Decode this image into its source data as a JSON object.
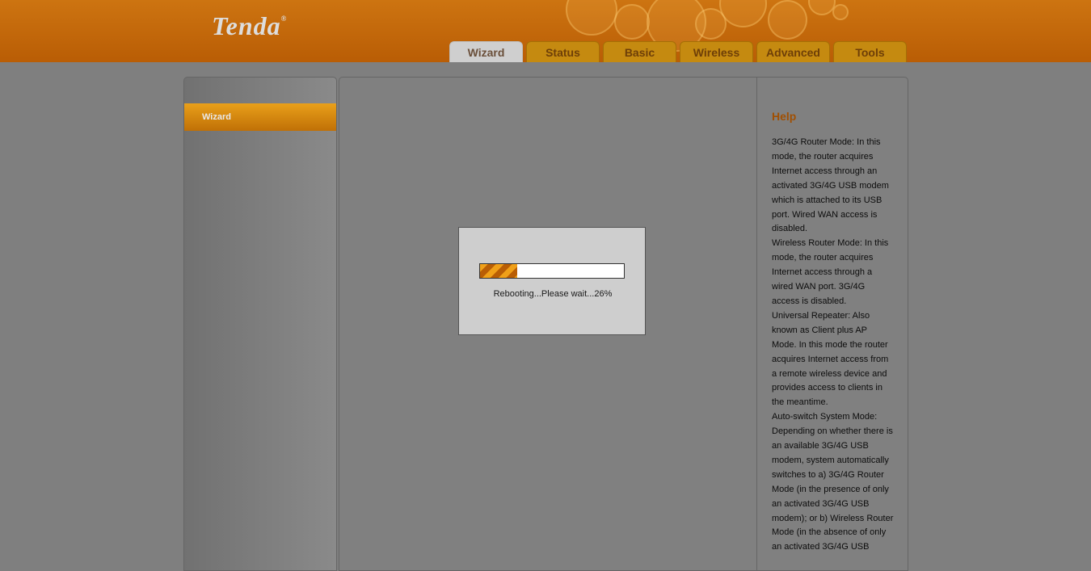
{
  "brand": {
    "logo_text": "Tenda",
    "trademark": "®"
  },
  "tabs": [
    {
      "label": "Wizard",
      "active": true
    },
    {
      "label": "Status",
      "active": false
    },
    {
      "label": "Basic",
      "active": false
    },
    {
      "label": "Wireless",
      "active": false
    },
    {
      "label": "Advanced",
      "active": false
    },
    {
      "label": "Tools",
      "active": false
    }
  ],
  "sidebar": {
    "items": [
      {
        "label": "Wizard",
        "active": true
      }
    ]
  },
  "dialog": {
    "message": "Rebooting...Please wait...26%",
    "progress": 0.26
  },
  "help": {
    "title": "Help",
    "paragraphs": [
      "3G/4G Router Mode: In this mode, the router acquires Internet access through an activated 3G/4G USB modem which is attached to its USB port. Wired WAN access is disabled.",
      "Wireless Router Mode: In this mode, the router acquires Internet access through a wired WAN port. 3G/4G access is disabled.",
      "Universal Repeater: Also known as Client plus AP Mode. In this mode the router acquires Internet access from a remote wireless device and provides access to clients in the meantime.",
      "Auto-switch System Mode: Depending on whether there is an available 3G/4G USB modem, system automatically switches to a) 3G/4G Router Mode (in the presence of only an activated 3G/4G USB modem); or b) Wireless Router Mode (in the absence of only an activated 3G/4G USB"
    ]
  },
  "colors": {
    "header": "#c66d0c",
    "accent": "#e9a01a",
    "overlay": "#808080",
    "help_title": "#a04f02"
  }
}
